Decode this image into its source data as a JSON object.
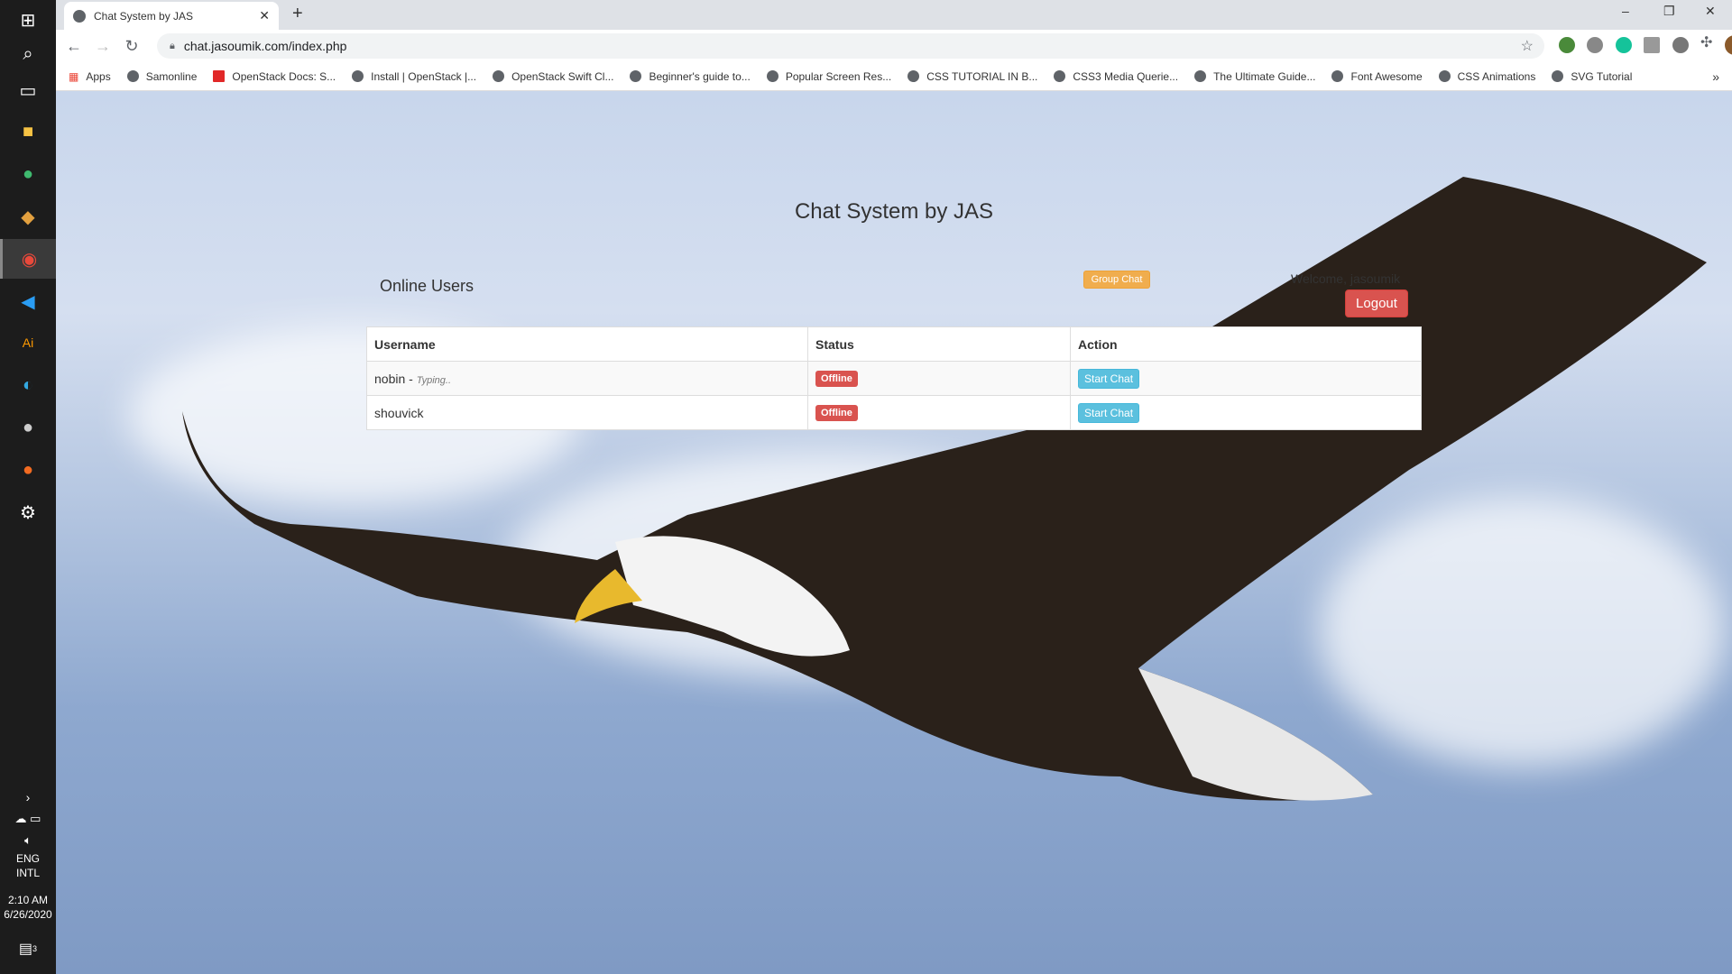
{
  "taskbar": {
    "lang1": "ENG",
    "lang2": "INTL",
    "time": "2:10 AM",
    "date": "6/26/2020",
    "notif_count": "3"
  },
  "browser": {
    "tab_title": "Chat System by JAS",
    "url": "chat.jasoumik.com/index.php",
    "bookmarks": [
      "Apps",
      "Samonline",
      "OpenStack Docs: S...",
      "Install | OpenStack |...",
      "OpenStack Swift Cl...",
      "Beginner's guide to...",
      "Popular Screen Res...",
      "CSS TUTORIAL IN B...",
      "CSS3 Media Querie...",
      "The Ultimate Guide...",
      "Font Awesome",
      "CSS Animations",
      "SVG Tutorial"
    ]
  },
  "page": {
    "title": "Chat System by JAS",
    "online_users": "Online Users",
    "group_chat": "Group Chat",
    "welcome": "Welcome, jasoumik",
    "logout": "Logout",
    "columns": [
      "Username",
      "Status",
      "Action"
    ],
    "rows": [
      {
        "username": "nobin",
        "typing": "Typing..",
        "status": "Offline",
        "action": "Start Chat"
      },
      {
        "username": "shouvick",
        "typing": "",
        "status": "Offline",
        "action": "Start Chat"
      }
    ]
  },
  "colors": {
    "warning": "#f0ad4e",
    "danger": "#d9534f",
    "info": "#5bc0de"
  }
}
